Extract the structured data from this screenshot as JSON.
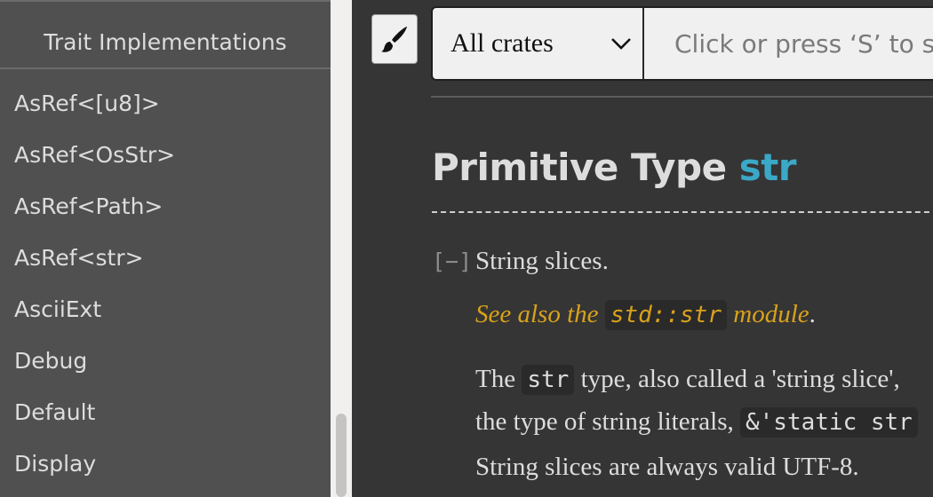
{
  "sidebar": {
    "title": "Trait Implementations",
    "items": [
      {
        "label": "AsRef<[u8]>"
      },
      {
        "label": "AsRef<OsStr>"
      },
      {
        "label": "AsRef<Path>"
      },
      {
        "label": "AsRef<str>"
      },
      {
        "label": "AsciiExt"
      },
      {
        "label": "Debug"
      },
      {
        "label": "Default"
      },
      {
        "label": "Display"
      }
    ]
  },
  "toolbar": {
    "theme_icon": "paintbrush-icon",
    "crate_select": "All crates",
    "search_placeholder": "Click or press ‘S’ to search, ‘?’ for more options…"
  },
  "content": {
    "heading_prefix": "Primitive Type",
    "heading_name": "str",
    "collapse_toggle": "[−]",
    "summary": "String slices.",
    "see_also_prefix": "See also the",
    "see_also_code": "std::str",
    "see_also_suffix": "module",
    "see_also_dot": ".",
    "desc_line1_prefix": "The",
    "desc_line1_code": "str",
    "desc_line1_suffix": "type, also called a 'string slice',",
    "desc_line2_prefix": "the type of string literals,",
    "desc_line2_code": "&'static str",
    "valid_utf8": "String slices are always valid UTF-8."
  }
}
